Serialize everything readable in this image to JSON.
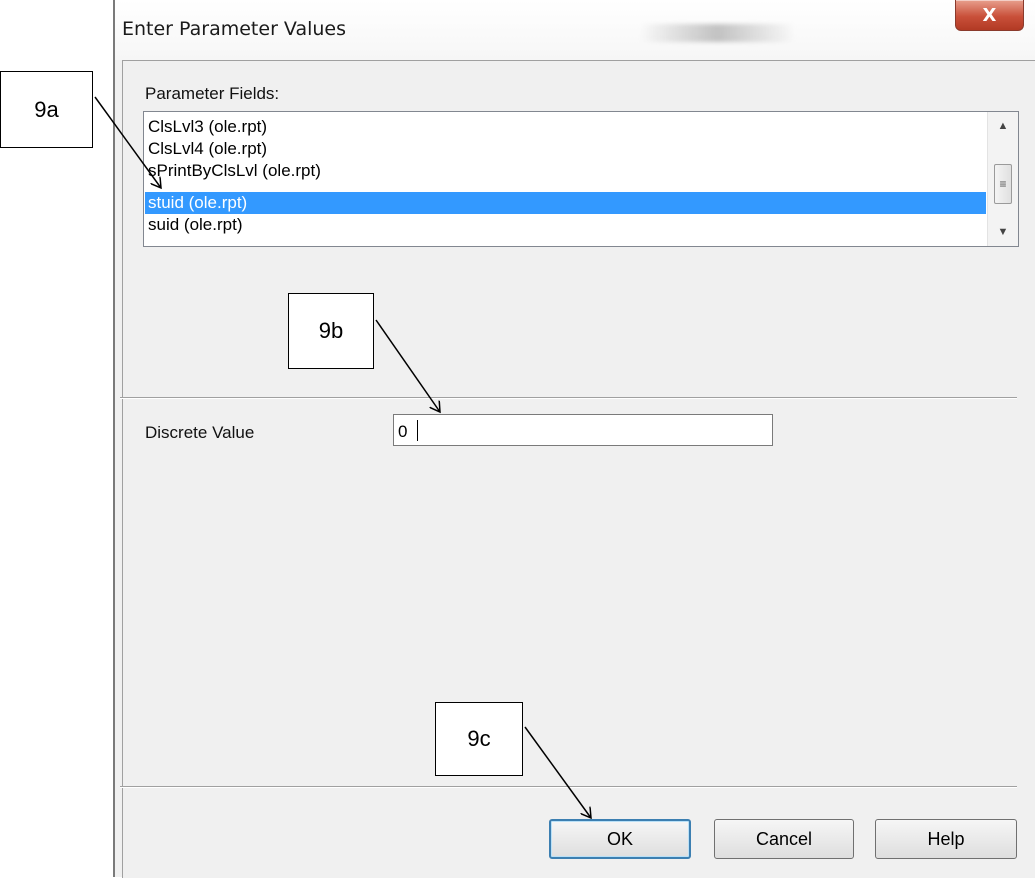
{
  "dialog": {
    "title": "Enter Parameter Values",
    "close_label": "X"
  },
  "parameter_fields": {
    "label": "Parameter Fields:",
    "items": [
      "ClsLvl3 (ole.rpt)",
      "ClsLvl4 (ole.rpt)",
      "sPrintByClsLvl (ole.rpt)",
      "stuid (ole.rpt)",
      "suid (ole.rpt)"
    ],
    "selected_index": 3
  },
  "discrete_value": {
    "label": "Discrete Value",
    "value": "0"
  },
  "buttons": {
    "ok": "OK",
    "cancel": "Cancel",
    "help": "Help"
  },
  "callouts": {
    "a": "9a",
    "b": "9b",
    "c": "9c"
  },
  "icons": {
    "scroll_up": "triangle-up-icon",
    "scroll_down": "triangle-down-icon",
    "scroll_grip": "grip-lines-icon"
  }
}
